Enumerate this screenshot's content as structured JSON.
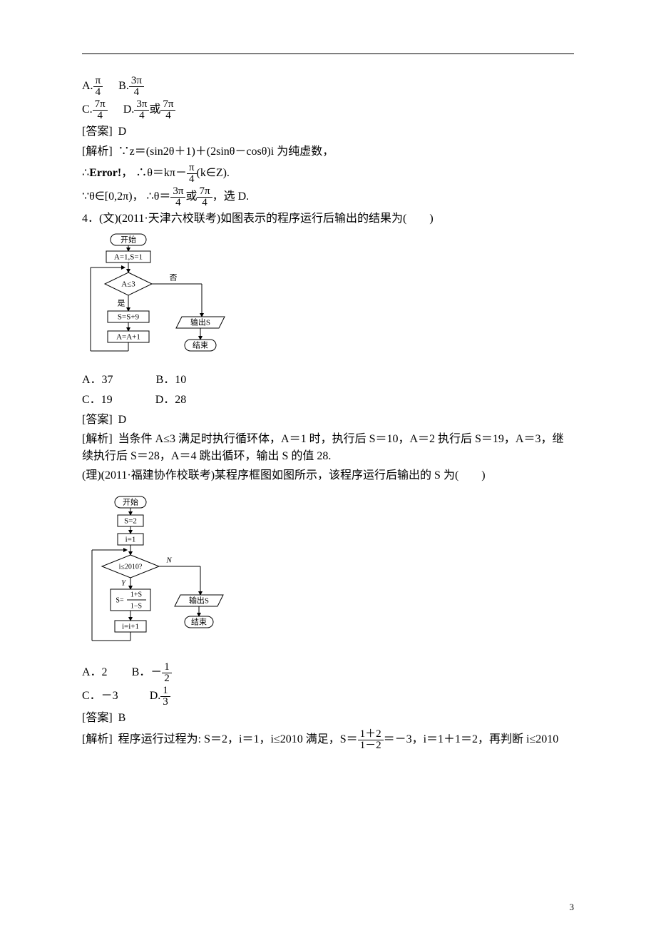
{
  "q3": {
    "optA_num": "π",
    "optA_den": "4",
    "optB_num": "3π",
    "optB_den": "4",
    "optC_num": "7π",
    "optC_den": "4",
    "optD1_num": "3π",
    "optD1_den": "4",
    "optD_or": "或",
    "optD2_num": "7π",
    "optD2_den": "4",
    "ans_label": "[答案]",
    "ans": "D",
    "anal_label": "[解析]",
    "anal_l1": "∵z＝(sin2θ＋1)＋(2sinθ－cosθ)i 为纯虚数，",
    "anal_l2a": "∴",
    "anal_err": "Error!",
    "anal_l2b": "，",
    "anal_l2c": "∴θ＝kπ－",
    "anal_kpi_num": "π",
    "anal_kpi_den": "4",
    "anal_l2d": "(k∈Z).",
    "anal_l3a": "∵θ∈[0,2π)，",
    "anal_l3b": "∴θ＝",
    "anal_r1_num": "3π",
    "anal_r1_den": "4",
    "anal_or": "或",
    "anal_r2_num": "7π",
    "anal_r2_den": "4",
    "anal_l3c": "，选 D."
  },
  "q4": {
    "stem": "4．(文)(2011·天津六校联考)如图表示的程序运行后输出的结果为(　　)",
    "fc": {
      "start": "开始",
      "init": "A=1,S=1",
      "cond": "A≤3",
      "yes": "是",
      "no": "否",
      "s1": "S=S+9",
      "s2": "A=A+1",
      "out": "输出S",
      "end": "结束"
    },
    "optA": "A．37",
    "optB": "B．10",
    "optC": "C．19",
    "optD": "D．28",
    "ans_label": "[答案]",
    "ans": "D",
    "anal_label": "[解析]",
    "anal": "当条件 A≤3 满足时执行循环体，A＝1 时，执行后 S＝10，A＝2 执行后 S＝19，A＝3，继续执行后 S＝28，A＝4 跳出循环，输出 S 的值 28."
  },
  "q4b": {
    "stem": "(理)(2011·福建协作校联考)某程序框图如图所示，该程序运行后输出的 S 为(　　)",
    "fc": {
      "start": "开始",
      "s0": "S=2",
      "i0": "i=1",
      "cond": "i≤2010?",
      "yes": "Y",
      "no": "N",
      "s1_lhs": "S=",
      "s1_num": "1+S",
      "s1_den": "1−S",
      "i1": "i=i+1",
      "out": "输出S",
      "end": "结束"
    },
    "optA": "A．2",
    "optB_pre": "B．－",
    "optB_num": "1",
    "optB_den": "2",
    "optC": "C．－3",
    "optD_pre": "D.",
    "optD_num": "1",
    "optD_den": "3",
    "ans_label": "[答案]",
    "ans": "B",
    "anal_label": "[解析]",
    "anal_a": "程序运行过程为: S＝2，i＝1，i≤2010 满足，S＝",
    "anal_f_num": "1＋2",
    "anal_f_den": "1－2",
    "anal_b": "＝－3，i＝1＋1＝2，再判断 i≤2010"
  },
  "page_number": "3"
}
